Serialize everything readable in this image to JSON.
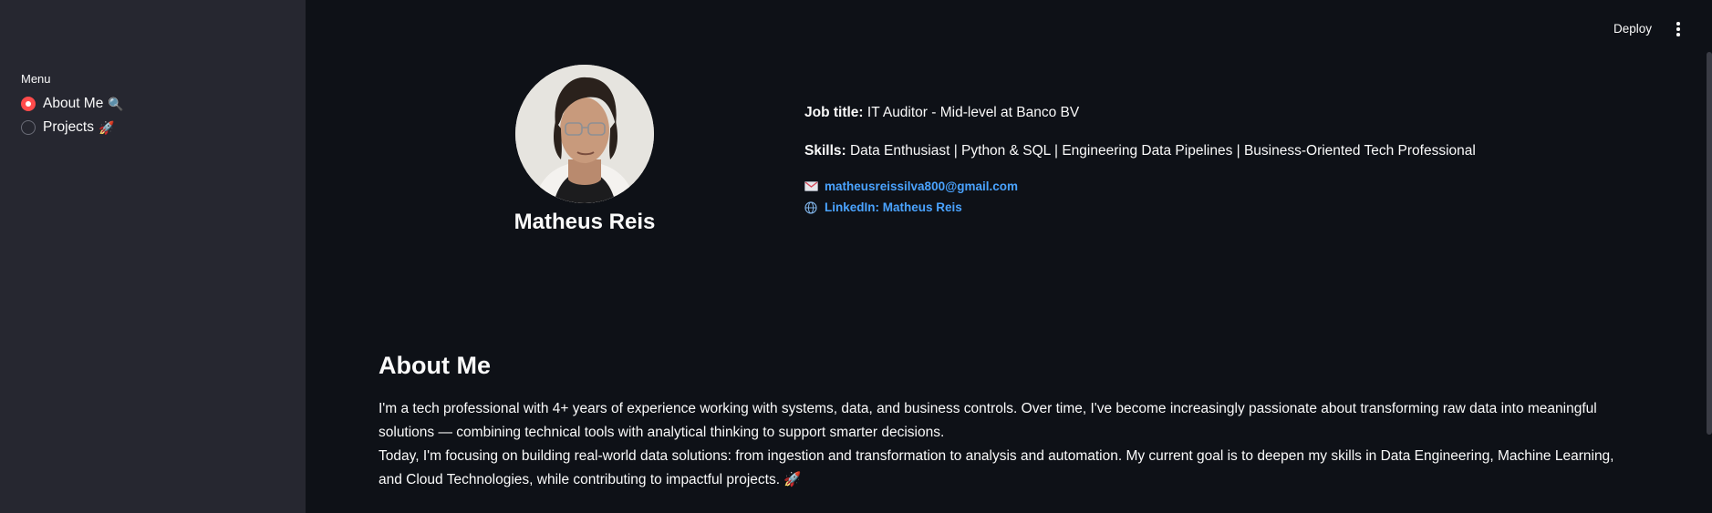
{
  "sidebar": {
    "menu_label": "Menu",
    "items": [
      {
        "label": "About Me",
        "emoji": "🔍",
        "selected": true
      },
      {
        "label": "Projects",
        "emoji": "🚀",
        "selected": false
      }
    ]
  },
  "header": {
    "deploy_label": "Deploy",
    "menu_icon": "kebab-menu-icon"
  },
  "profile": {
    "name": "Matheus Reis",
    "avatar_icon": "profile-photo",
    "job_title_label": "Job title:",
    "job_title_value": "IT Auditor - Mid-level at Banco BV",
    "skills_label": "Skills:",
    "skills_value": "Data Enthusiast | Python & SQL | Engineering Data Pipelines | Business-Oriented Tech Professional",
    "email": "matheusreissilva800@gmail.com",
    "email_icon": "envelope-icon",
    "linkedin": "LinkedIn: Matheus Reis",
    "linkedin_icon": "globe-icon"
  },
  "about": {
    "title": "About Me",
    "paragraph1": "I'm a tech professional with 4+ years of experience working with systems, data, and business controls. Over time, I've become increasingly passionate about transforming raw data into meaningful solutions — combining technical tools with analytical thinking to support smarter decisions.",
    "paragraph2": "Today, I'm focusing on building real-world data solutions: from ingestion and transformation to analysis and automation. My current goal is to deepen my skills in Data Engineering, Machine Learning, and Cloud Technologies, while contributing to impactful projects.",
    "paragraph2_emoji": "🚀"
  },
  "colors": {
    "background": "#0e1117",
    "sidebar": "#262730",
    "accent": "#ff4b4b",
    "link": "#4aa3ff"
  }
}
